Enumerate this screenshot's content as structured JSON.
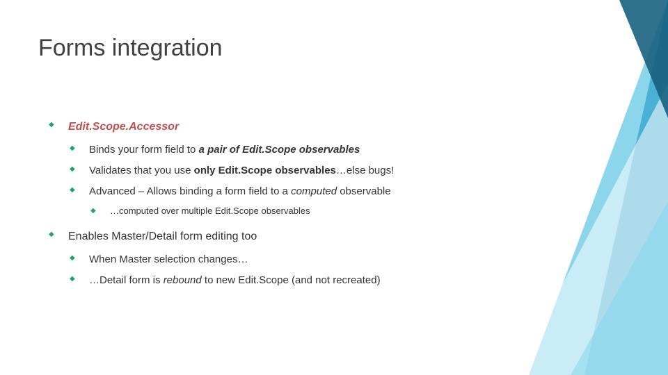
{
  "title": "Forms integration",
  "l1a_title": "Edit.Scope.Accessor",
  "l2a_pre": "Binds your form field to ",
  "l2a_emph": "a pair of Edit.Scope observables",
  "l2b_pre": "Validates that you use ",
  "l2b_bold": "only Edit.Scope observables",
  "l2b_post": "…else bugs!",
  "l2c_pre": "Advanced – Allows binding a form field to a ",
  "l2c_ital": "computed",
  "l2c_post": " observable",
  "l3a": "…computed over multiple Edit.Scope observables",
  "l1b": "Enables Master/Detail form editing too",
  "l2d": "When Master selection changes…",
  "l2e_pre": "…Detail form is ",
  "l2e_ital": "rebound",
  "l2e_post": " to new Edit.Scope (and not recreated)"
}
